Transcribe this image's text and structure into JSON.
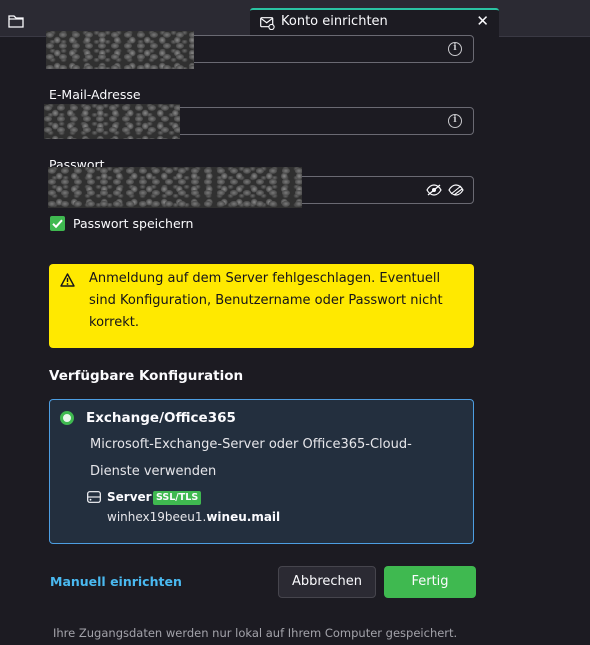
{
  "tab": {
    "title": "Konto einrichten",
    "close_glyph": "✕",
    "icon": "mail-gear-icon"
  },
  "form": {
    "email_label": "E-Mail-Adresse",
    "password_label": "Passwort",
    "remember_password_label": "Passwort speichern",
    "remember_password_checked": true
  },
  "warning": {
    "icon": "warning-triangle-icon",
    "text": "Anmeldung auf dem Server fehlgeschlagen. Eventuell sind Konfiguration, Benutzername oder Passwort nicht korrekt."
  },
  "config": {
    "section_title": "Verfügbare Konfiguration",
    "option_title": "Exchange/Office365",
    "option_selected": true,
    "option_description": "Microsoft-Exchange-Server oder Office365-Cloud-Dienste verwenden",
    "server_label": "Server",
    "ssl_badge": "SSL/TLS",
    "host_prefix": "winhex19beeu1.",
    "host_domain": "wineu.mail"
  },
  "actions": {
    "manual_link": "Manuell einrichten",
    "cancel_label": "Abbrechen",
    "done_label": "Fertig"
  },
  "footer": {
    "note": "Ihre Zugangsdaten werden nur lokal auf Ihrem Computer gespeichert."
  },
  "colors": {
    "background": "#1c1b22",
    "accent_green": "#3fb950",
    "warning_yellow": "#ffe900",
    "link_blue": "#4ab9f0",
    "card_border": "#4d9ee2"
  }
}
